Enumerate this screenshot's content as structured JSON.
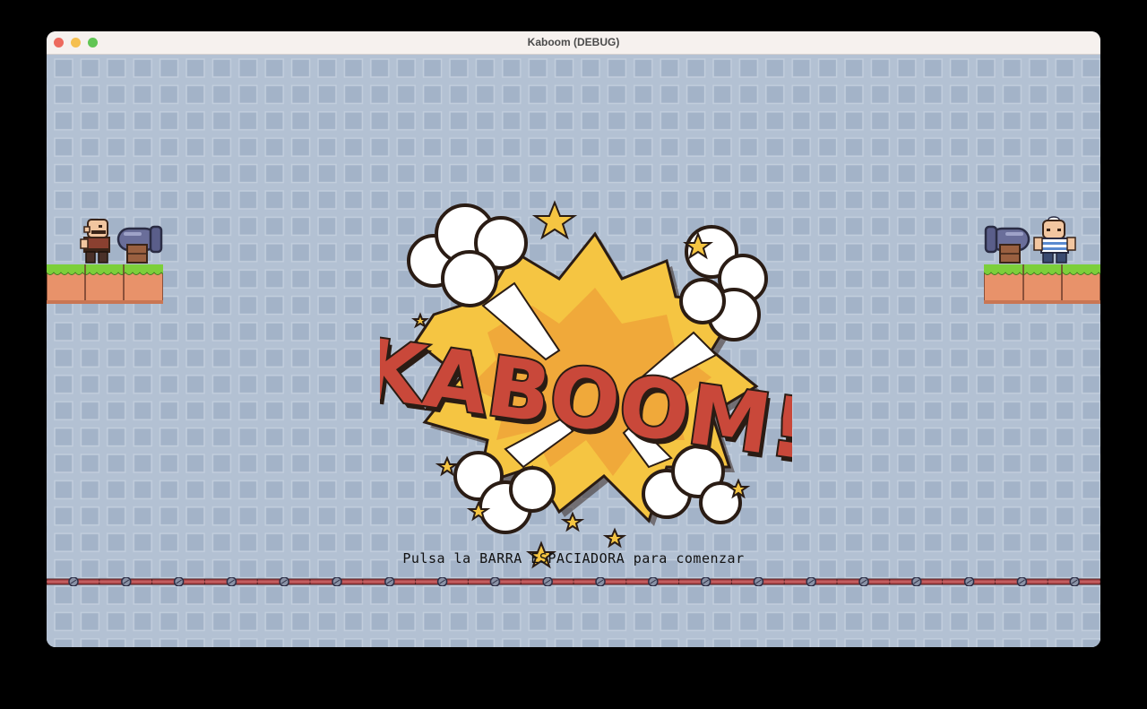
{
  "window": {
    "title": "Kaboom (DEBUG)"
  },
  "logo": {
    "text": "KABOOM!"
  },
  "prompt": {
    "text": "Pulsa la BARRA ESPACIADORA para comenzar"
  },
  "colors": {
    "background": "#b0bfd2",
    "tile": "#a3b3c8",
    "grass": "#7ccf3a",
    "dirt": "#e8926a",
    "burst": "#f5c542",
    "logo_red": "#c9483a",
    "chain": "#b0474a"
  },
  "characters": [
    {
      "name": "bald-pirate-left",
      "side": "left"
    },
    {
      "name": "sailor-right",
      "side": "right"
    }
  ]
}
